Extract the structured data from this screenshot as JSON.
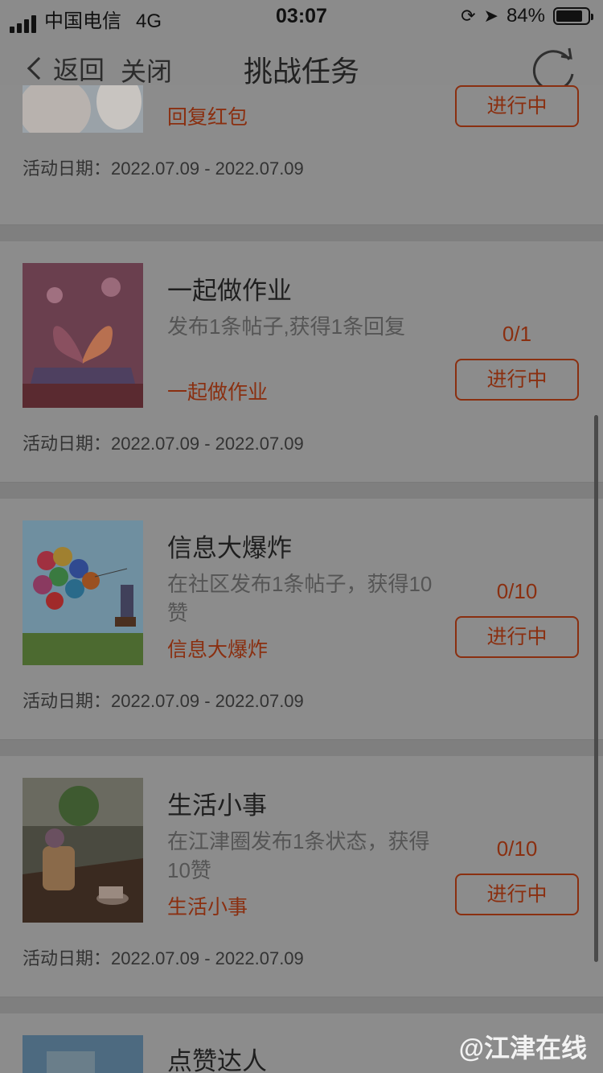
{
  "status_bar": {
    "carrier": "中国电信",
    "network": "4G",
    "time": "03:07",
    "battery": "84%",
    "battery_level": 0.84
  },
  "nav": {
    "back_label": "返回",
    "close_label": "关闭",
    "title": "挑战任务"
  },
  "tasks": [
    {
      "tag": "回复红包",
      "status": "进行中",
      "date_label": "活动日期：",
      "date_range": "2022.07.09 - 2022.07.09"
    },
    {
      "name": "一起做作业",
      "description": "发布1条帖子,获得1条回复",
      "tag": "一起做作业",
      "progress": "0/1",
      "status": "进行中",
      "date_label": "活动日期：",
      "date_range": "2022.07.09 - 2022.07.09"
    },
    {
      "name": "信息大爆炸",
      "description": "在社区发布1条帖子，获得10赞",
      "tag": "信息大爆炸",
      "progress": "0/10",
      "status": "进行中",
      "date_label": "活动日期：",
      "date_range": "2022.07.09 - 2022.07.09"
    },
    {
      "name": "生活小事",
      "description": "在江津圈发布1条状态，获得10赞",
      "tag": "生活小事",
      "progress": "0/10",
      "status": "进行中",
      "date_label": "活动日期：",
      "date_range": "2022.07.09 - 2022.07.09"
    },
    {
      "name": "点赞达人"
    }
  ],
  "watermark": "@江津在线",
  "colors": {
    "accent": "#8a2f10",
    "overlay_bg": "#8b8b8b"
  }
}
